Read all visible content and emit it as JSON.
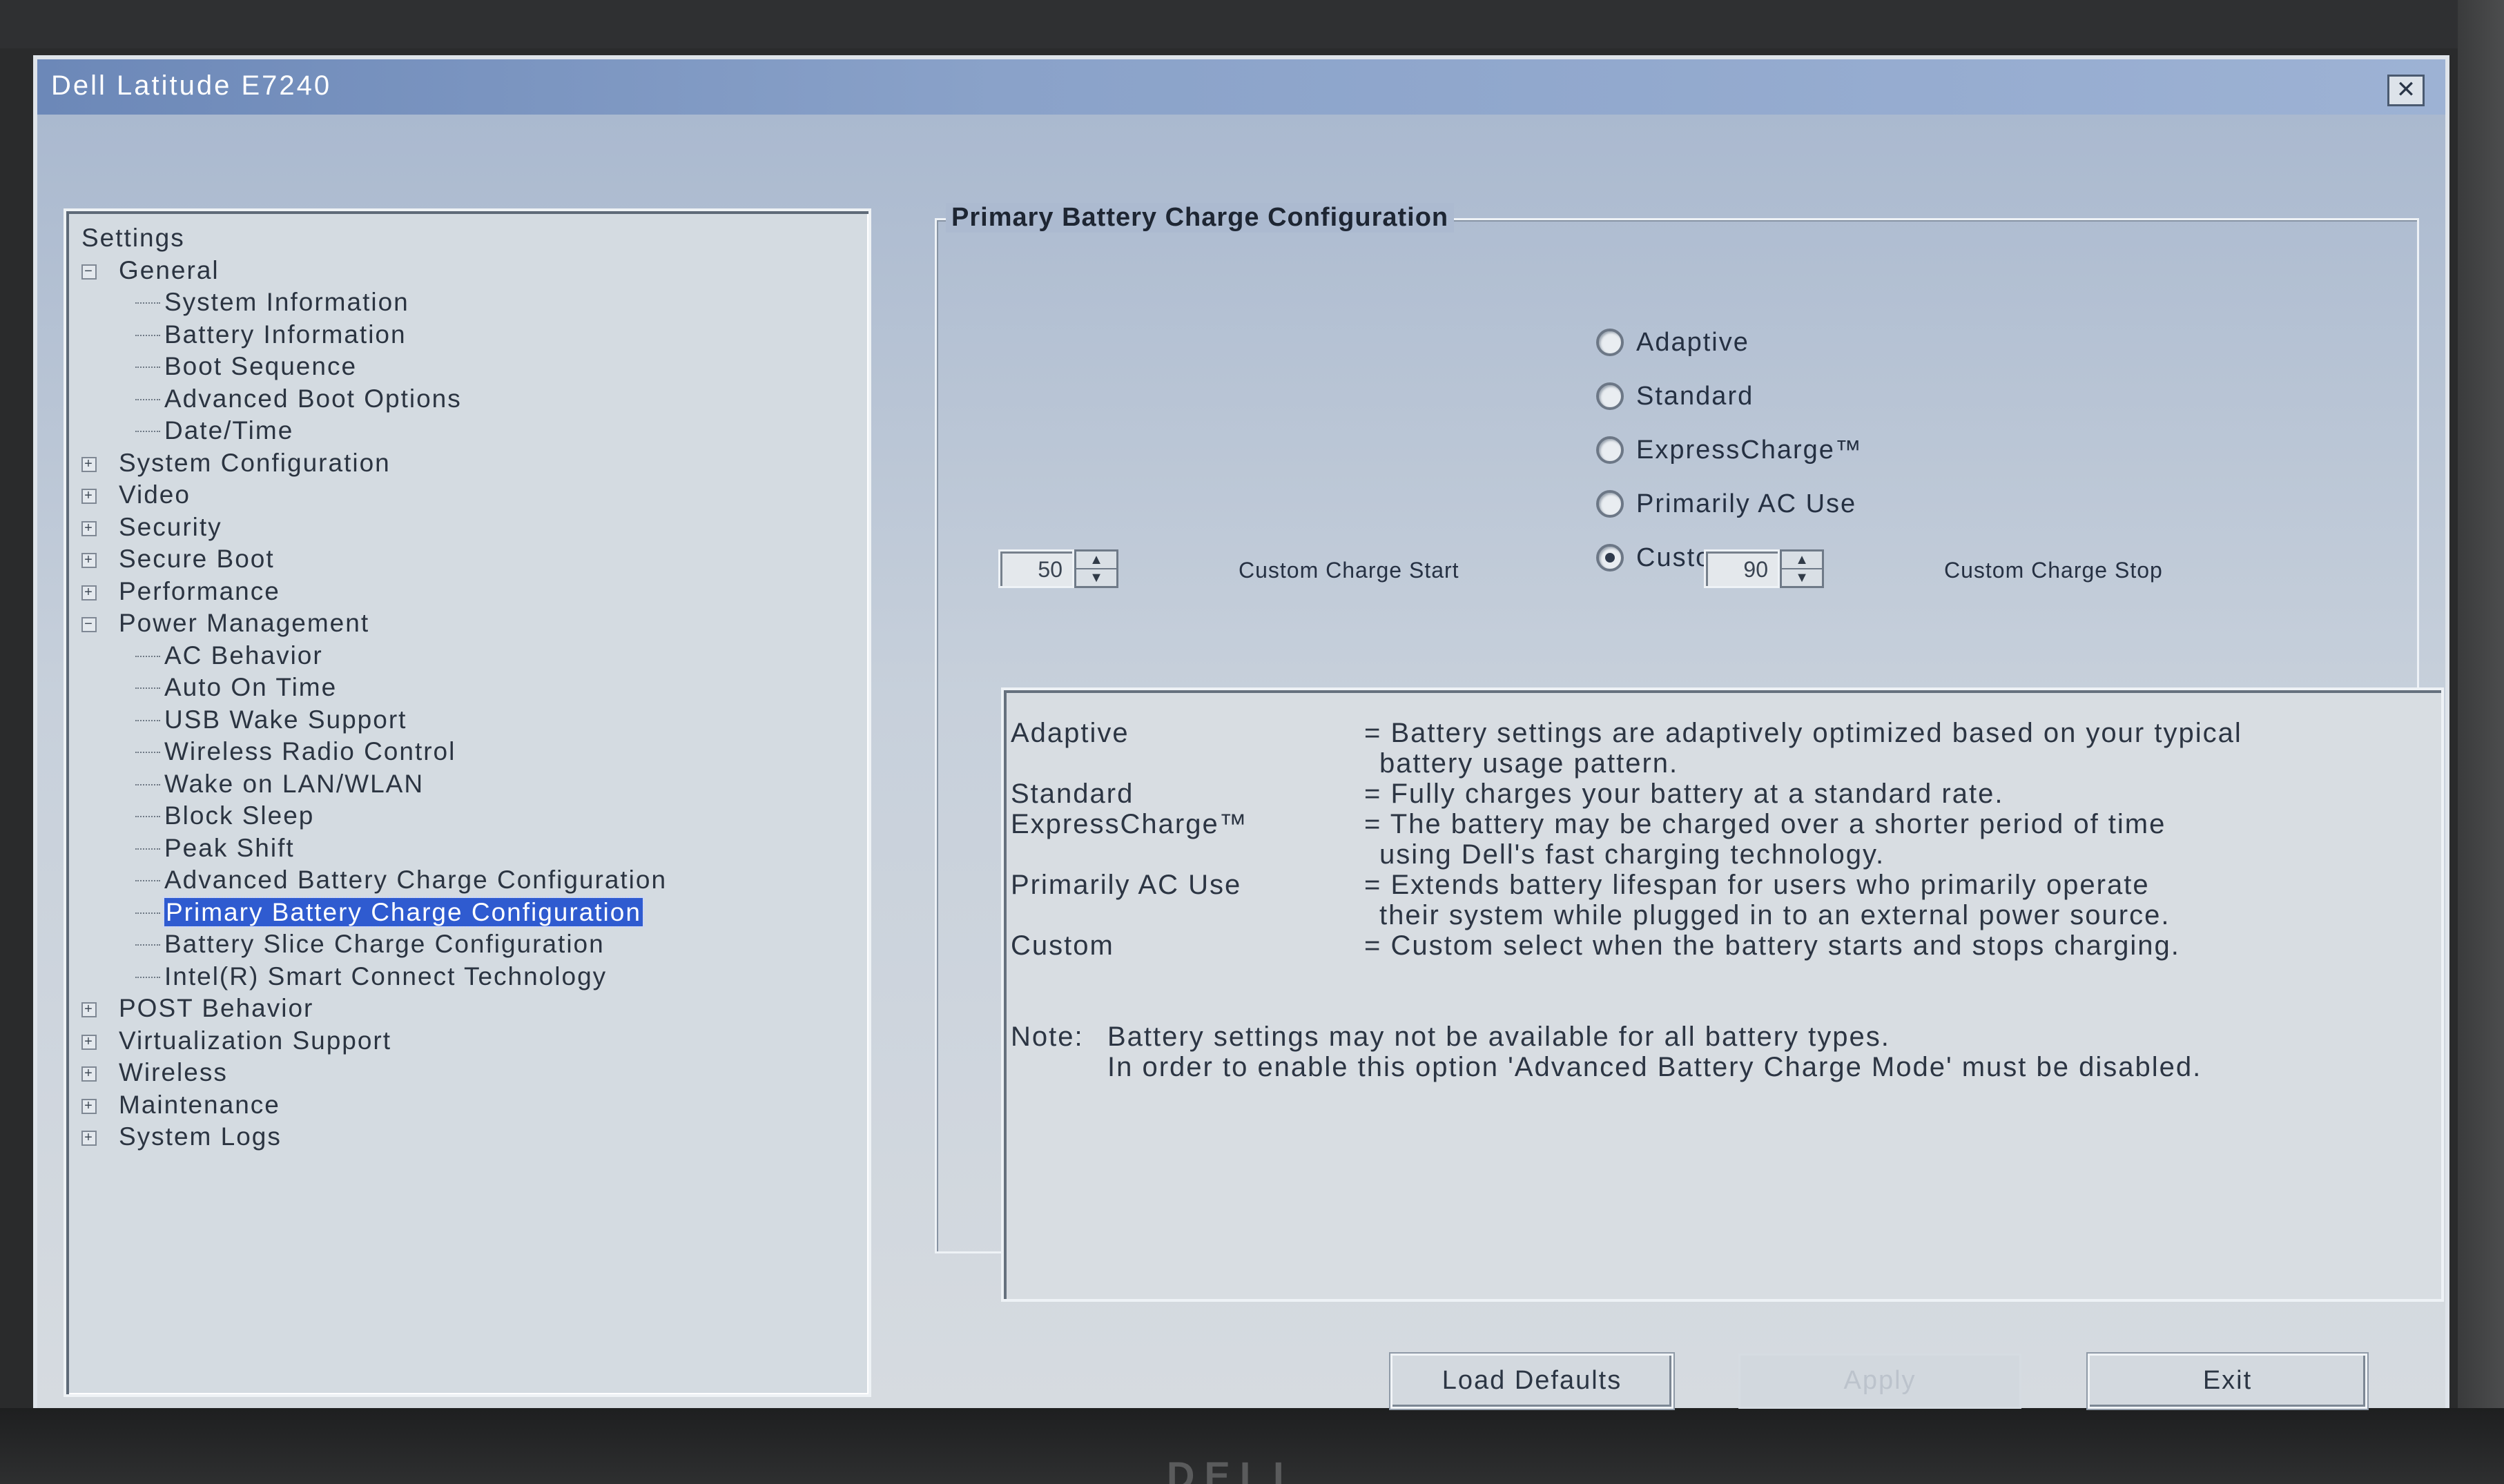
{
  "window": {
    "title": "Dell Latitude E7240",
    "close_glyph": "✕"
  },
  "tree": {
    "root": "Settings",
    "groups": [
      {
        "label": "General",
        "expanded": true,
        "children": [
          "System Information",
          "Battery Information",
          "Boot Sequence",
          "Advanced Boot Options",
          "Date/Time"
        ]
      },
      {
        "label": "System Configuration",
        "expanded": false
      },
      {
        "label": "Video",
        "expanded": false
      },
      {
        "label": "Security",
        "expanded": false
      },
      {
        "label": "Secure Boot",
        "expanded": false
      },
      {
        "label": "Performance",
        "expanded": false
      },
      {
        "label": "Power Management",
        "expanded": true,
        "children": [
          "AC Behavior",
          "Auto On Time",
          "USB Wake Support",
          "Wireless Radio Control",
          "Wake on LAN/WLAN",
          "Block Sleep",
          "Peak Shift",
          "Advanced Battery Charge Configuration",
          "Primary Battery Charge Configuration",
          "Battery Slice Charge Configuration",
          "Intel(R) Smart Connect Technology"
        ]
      },
      {
        "label": "POST Behavior",
        "expanded": false
      },
      {
        "label": "Virtualization Support",
        "expanded": false
      },
      {
        "label": "Wireless",
        "expanded": false
      },
      {
        "label": "Maintenance",
        "expanded": false
      },
      {
        "label": "System Logs",
        "expanded": false
      }
    ],
    "selected": "Primary Battery Charge Configuration",
    "expand_glyph": "+",
    "collapse_glyph": "−"
  },
  "panel": {
    "title": "Primary Battery Charge Configuration",
    "options": [
      {
        "label": "Adaptive",
        "checked": false
      },
      {
        "label": "Standard",
        "checked": false
      },
      {
        "label": "ExpressCharge™",
        "checked": false
      },
      {
        "label": "Primarily AC Use",
        "checked": false
      },
      {
        "label": "Custom",
        "checked": true
      }
    ],
    "custom_start": {
      "value": "50",
      "label": "Custom Charge Start"
    },
    "custom_stop": {
      "value": "90",
      "label": "Custom Charge Stop"
    },
    "spin_up": "▲",
    "spin_down": "▼"
  },
  "description": {
    "entries": [
      {
        "term": "Adaptive",
        "lines": [
          "= Battery settings are adaptively optimized based on your typical",
          "battery usage pattern."
        ]
      },
      {
        "term": "Standard",
        "lines": [
          "= Fully charges your battery at a standard rate."
        ]
      },
      {
        "term": "ExpressCharge™",
        "lines": [
          "= The battery may be charged over a shorter period of time",
          "using Dell's fast charging technology."
        ]
      },
      {
        "term": "Primarily AC Use",
        "lines": [
          "= Extends battery lifespan for users who primarily operate",
          "their system while plugged in to an external power source."
        ]
      },
      {
        "term": "Custom",
        "lines": [
          "= Custom select when the battery starts and stops charging."
        ]
      }
    ],
    "note_label": "Note:",
    "note_lines": [
      "Battery settings may not be available for all battery types.",
      "In order to enable this option 'Advanced Battery Charge Mode' must be disabled."
    ]
  },
  "buttons": {
    "load_defaults": "Load Defaults",
    "apply": "Apply",
    "exit": "Exit"
  },
  "bezel_logo": "DELL"
}
